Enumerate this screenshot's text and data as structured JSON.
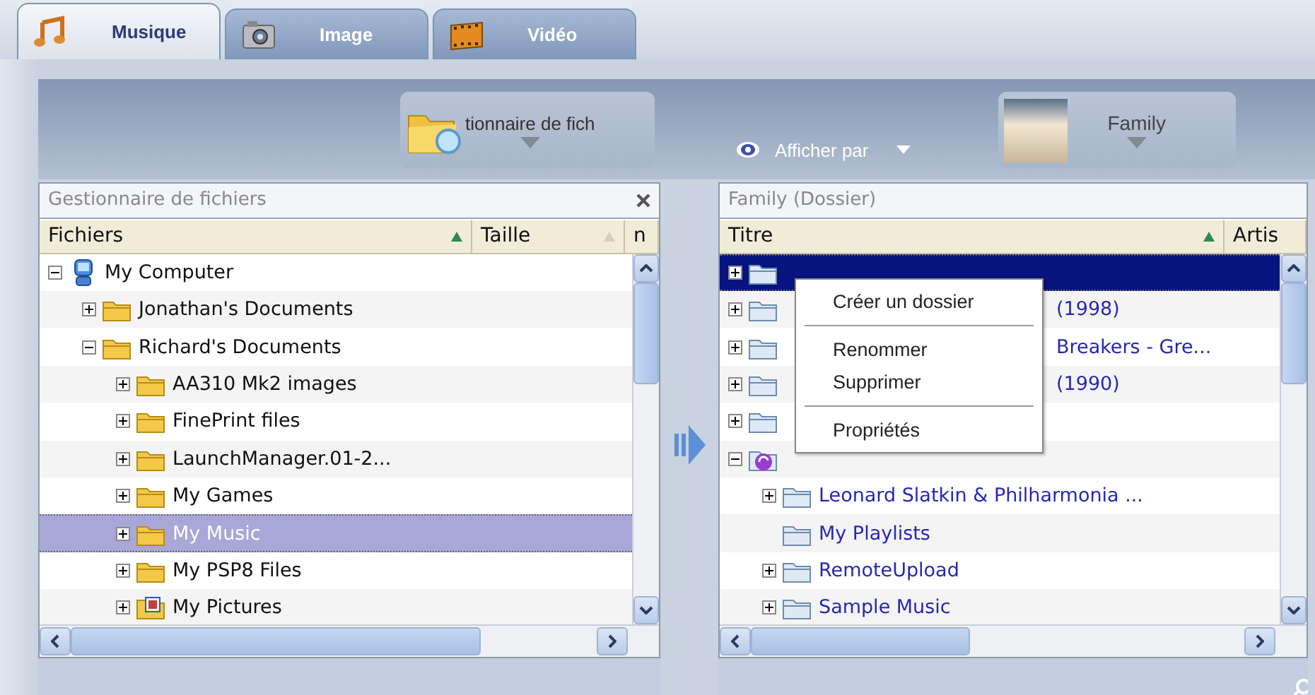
{
  "tabs": [
    {
      "label": "Musique",
      "kind": "music",
      "selected": true
    },
    {
      "label": "Image",
      "kind": "camera",
      "selected": false
    },
    {
      "label": "Vidéo",
      "kind": "film",
      "selected": false
    }
  ],
  "toolbar": {
    "source": {
      "label": "tionnaire de fich"
    },
    "view": {
      "label": "Afficher par"
    },
    "album": {
      "label": "Family"
    }
  },
  "panels": [
    {
      "kind": "files",
      "title": "Gestionnaire de fichiers",
      "closable": true,
      "columns": [
        {
          "label": "Fichiers",
          "sorted": true
        },
        {
          "label": "Taille",
          "sorted": false
        },
        {
          "label": "n"
        }
      ],
      "tree": [
        {
          "label": "My Computer",
          "kind": "computer",
          "expanded": true,
          "selected": false,
          "children": [
            {
              "label": "Jonathan's Documents",
              "kind": "folder",
              "expanded": false,
              "selected": false
            },
            {
              "label": "Richard's Documents",
              "kind": "folder",
              "expanded": true,
              "selected": false,
              "children": [
                {
                  "label": "AA310 Mk2 images",
                  "kind": "folder",
                  "expanded": false,
                  "selected": false
                },
                {
                  "label": "FinePrint files",
                  "kind": "folder",
                  "expanded": false,
                  "selected": false
                },
                {
                  "label": "LaunchManager.01-2...",
                  "kind": "folder",
                  "expanded": false,
                  "selected": false
                },
                {
                  "label": "My Games",
                  "kind": "folder",
                  "expanded": false,
                  "selected": false
                },
                {
                  "label": "My Music",
                  "kind": "folder",
                  "expanded": false,
                  "selected": true
                },
                {
                  "label": "My PSP8 Files",
                  "kind": "folder",
                  "expanded": false,
                  "selected": false
                },
                {
                  "label": "My Pictures",
                  "kind": "picture-folder",
                  "expanded": false,
                  "selected": false
                }
              ]
            }
          ]
        }
      ]
    },
    {
      "kind": "library",
      "title": "Family (Dossier)",
      "closable": false,
      "columns": [
        {
          "label": "Titre",
          "sorted": true
        },
        {
          "label": "Artis"
        }
      ],
      "tree": [
        {
          "kind": "folder",
          "expanded": false,
          "selected": true
        },
        {
          "label": "(1998)",
          "kind": "covered-folder",
          "expanded": false,
          "selected": false
        },
        {
          "label": "Breakers - Gre...",
          "kind": "covered-folder",
          "expanded": false,
          "selected": false
        },
        {
          "label": "(1990)",
          "kind": "covered-folder",
          "expanded": false,
          "selected": false
        },
        {
          "kind": "folder",
          "expanded": false,
          "selected": false
        },
        {
          "kind": "music-folder",
          "expanded": true,
          "selected": false,
          "children": [
            {
              "label": "Leonard Slatkin & Philharmonia ...",
              "kind": "folder",
              "expanded": false,
              "selected": false
            },
            {
              "label": "My Playlists",
              "kind": "empty-folder",
              "selected": false
            },
            {
              "label": "RemoteUpload",
              "kind": "folder",
              "expanded": false,
              "selected": false
            },
            {
              "label": "Sample Music",
              "kind": "folder",
              "expanded": false,
              "selected": false
            }
          ]
        }
      ],
      "context_menu": [
        {
          "kind": "item",
          "label": "Créer un dossier"
        },
        {
          "kind": "separator"
        },
        {
          "kind": "item",
          "label": "Renommer"
        },
        {
          "kind": "item",
          "label": "Supprimer"
        },
        {
          "kind": "separator"
        },
        {
          "kind": "item",
          "label": "Propriétés"
        }
      ]
    }
  ]
}
